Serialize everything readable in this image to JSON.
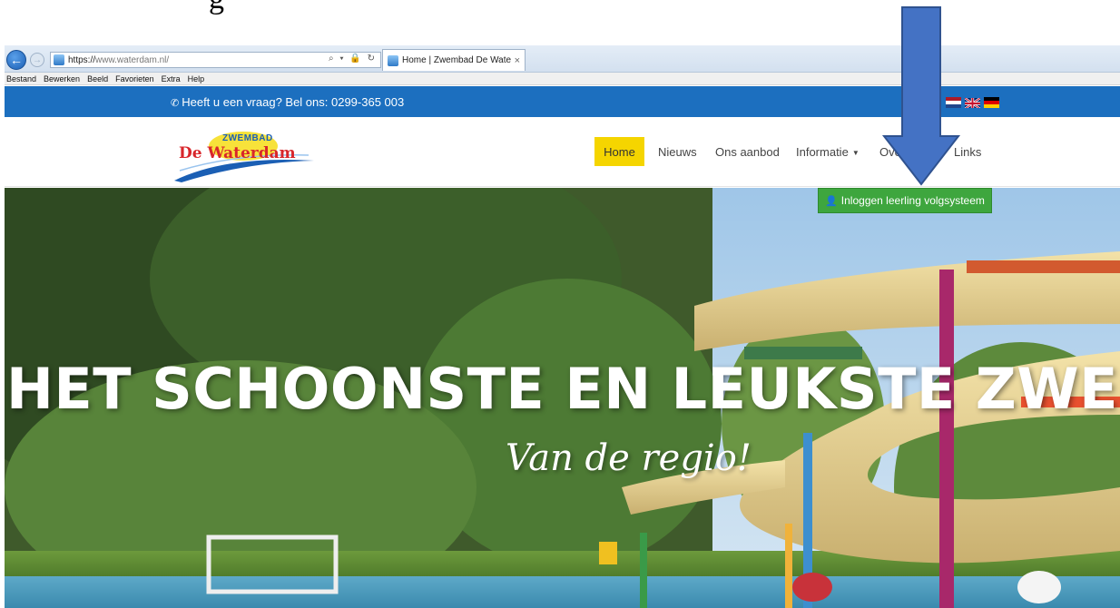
{
  "document_snippet": "g",
  "browser": {
    "back_icon": "back-arrow-icon",
    "forward_icon": "forward-arrow-icon",
    "address": {
      "scheme": "https://",
      "domain": "www.waterdam.nl/"
    },
    "address_tools": "⌕ ▾ 🔒 ↻",
    "tab": {
      "title": "Home | Zwembad De Water...",
      "close": "×"
    },
    "menu": [
      "Bestand",
      "Bewerken",
      "Beeld",
      "Favorieten",
      "Extra",
      "Help"
    ]
  },
  "site": {
    "topbar": {
      "phone_text": "Heeft u een vraag? Bel ons: 0299-365 003",
      "flags": [
        "nl-flag-icon",
        "uk-flag-icon",
        "de-flag-icon"
      ],
      "color": "#1c6fbf"
    },
    "logo": {
      "sub": "ZWEMBAD",
      "main_de": "De",
      "main_waterdam": "Waterdam"
    },
    "nav": {
      "home": "Home",
      "nieuws": "Nieuws",
      "aanbod": "Ons aanbod",
      "informatie": "Informatie",
      "over_partial": "Ove",
      "links_partial": "Links"
    },
    "login_button": "Inloggen leerling volgsysteem",
    "hero": {
      "title": "HET SCHOONSTE EN LEUKSTE ZWEMI",
      "subtitle": "Van de regio!"
    },
    "colors": {
      "home_highlight": "#f5d500",
      "login_green": "#3ea63e",
      "arrow_blue": "#4472c4"
    }
  }
}
